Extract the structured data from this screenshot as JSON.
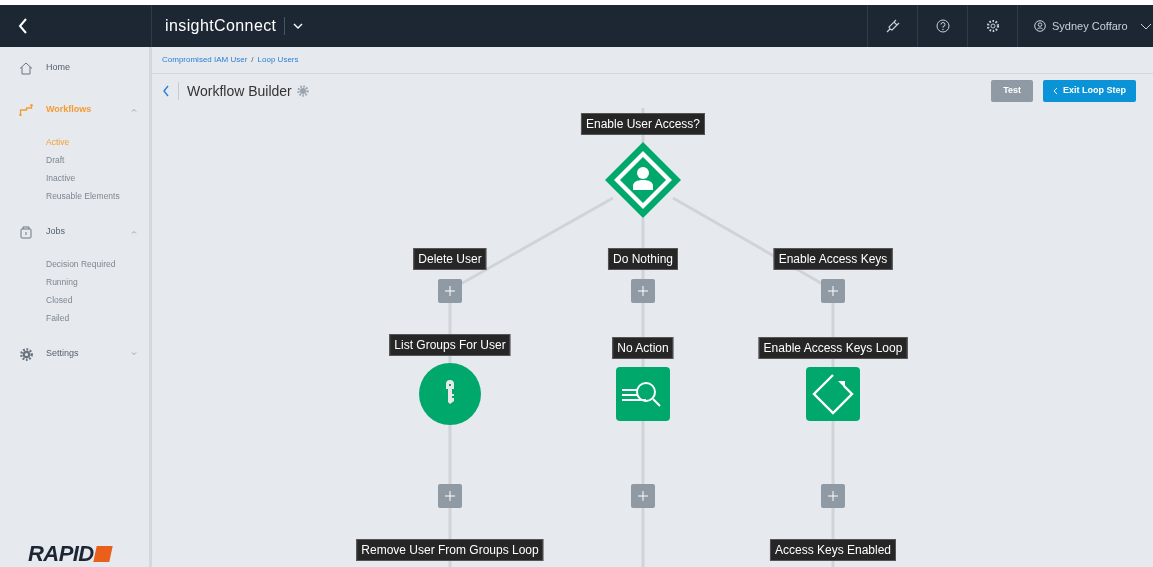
{
  "topbar": {
    "app_name_light": "insight",
    "app_name_bold": "Connect",
    "user": "Sydney Coffaro"
  },
  "sidebar": {
    "items": [
      {
        "label": "Home",
        "kind": "home",
        "selected": false
      },
      {
        "label": "Workflows",
        "kind": "workflow",
        "selected": true,
        "expanded": true,
        "children": [
          {
            "label": "Active",
            "selected": true
          },
          {
            "label": "Draft",
            "selected": false
          },
          {
            "label": "Inactive",
            "selected": false
          },
          {
            "label": "Reusable Elements",
            "selected": false
          }
        ]
      },
      {
        "label": "Jobs",
        "kind": "jobs",
        "selected": false,
        "expanded": true,
        "children": [
          {
            "label": "Decision Required",
            "selected": false
          },
          {
            "label": "Running",
            "selected": false
          },
          {
            "label": "Closed",
            "selected": false
          },
          {
            "label": "Failed",
            "selected": false
          }
        ]
      },
      {
        "label": "Settings",
        "kind": "settings",
        "selected": false,
        "expanded": false
      }
    ],
    "logo": "RAPID"
  },
  "breadcrumb": {
    "items": [
      "Compromised IAM User",
      "Loop Users"
    ],
    "separator": "/"
  },
  "header": {
    "title": "Workflow Builder",
    "buttons": [
      {
        "label": "Test",
        "kind": "secondary"
      },
      {
        "label": "Exit Loop Step",
        "kind": "primary"
      }
    ]
  },
  "workflow": {
    "decision": "Enable User Access?",
    "branches": [
      {
        "label": "Delete User",
        "step": {
          "label": "List Groups For User",
          "kind": "key"
        },
        "next": "Remove User From Groups Loop"
      },
      {
        "label": "Do Nothing",
        "step": {
          "label": "No Action",
          "kind": "search"
        }
      },
      {
        "label": "Enable Access Keys",
        "step": {
          "label": "Enable Access Keys Loop",
          "kind": "loop"
        },
        "next": "Access Keys Enabled"
      }
    ]
  }
}
